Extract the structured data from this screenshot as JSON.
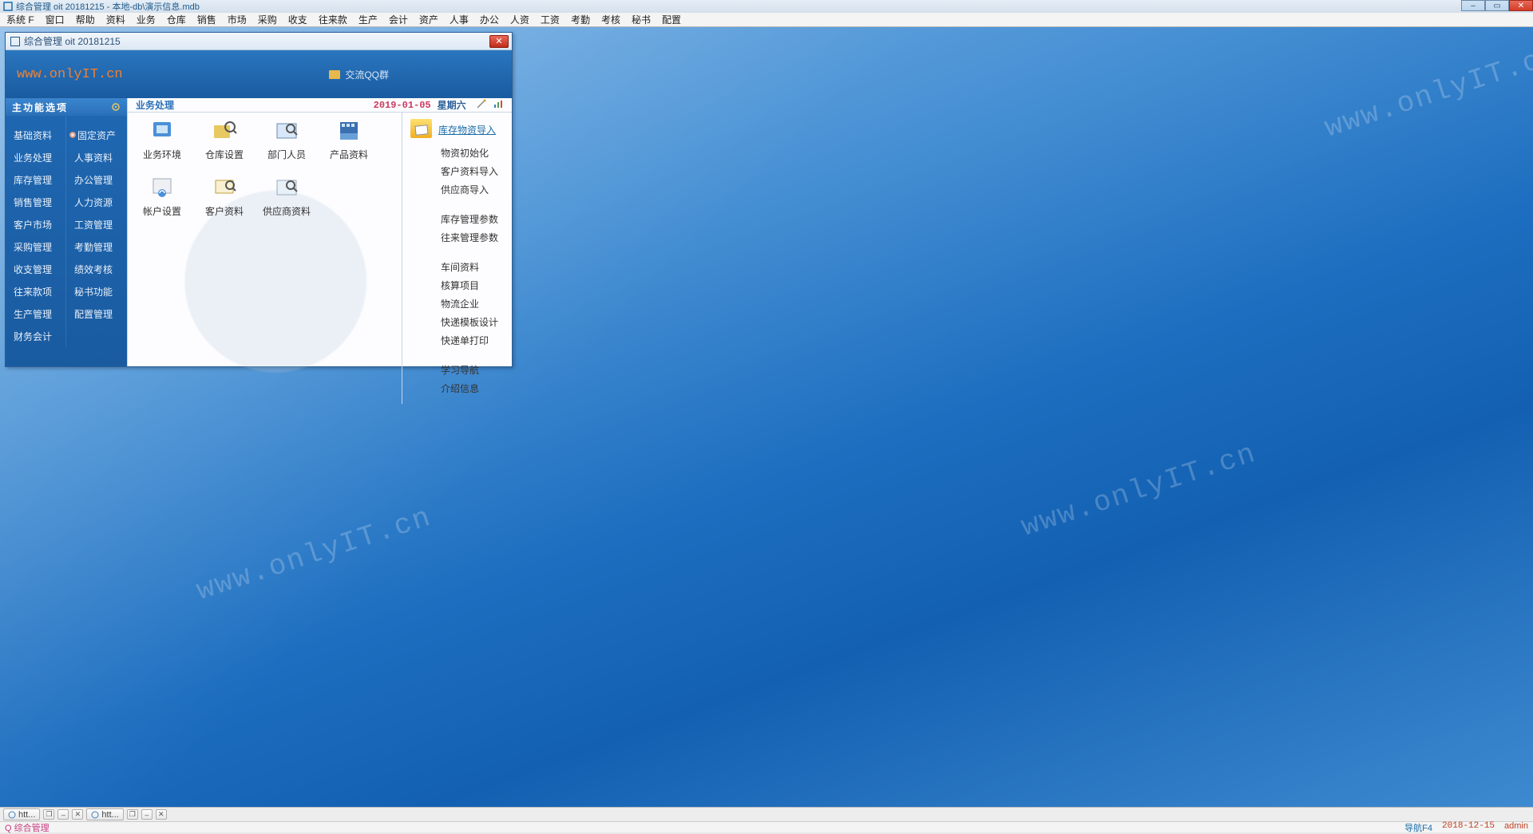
{
  "app": {
    "title": "综合管理 oit 20181215 - 本地-db\\演示信息.mdb",
    "window_buttons": {
      "min": "–",
      "max": "▭",
      "close": "✕"
    }
  },
  "menubar": [
    "系统 F",
    "窗口",
    "帮助",
    "资料",
    "业务",
    "仓库",
    "销售",
    "市场",
    "采购",
    "收支",
    "往来款",
    "生产",
    "会计",
    "资产",
    "人事",
    "办公",
    "人资",
    "工资",
    "考勤",
    "考核",
    "秘书",
    "配置"
  ],
  "child": {
    "title": "综合管理 oit 20181215",
    "url": "www.onlyIT.cn",
    "qq_label": "交流QQ群",
    "sidebar": {
      "header": "主功能选项",
      "col1": [
        "基础资料",
        "业务处理",
        "库存管理",
        "销售管理",
        "客户市场",
        "采购管理",
        "收支管理",
        "往来款项",
        "生产管理",
        "财务会计"
      ],
      "col2": [
        "固定资产",
        "人事资料",
        "办公管理",
        "人力资源",
        "工资管理",
        "考勤管理",
        "绩效考核",
        "秘书功能",
        "配置管理"
      ]
    },
    "main": {
      "header_label": "业务处理",
      "date": "2019-01-05",
      "day": "星期六",
      "icons_row1": [
        "业务环境",
        "仓库设置",
        "部门人员",
        "产品资料"
      ],
      "icons_row2": [
        "帐户设置",
        "客户资料",
        "供应商资料"
      ],
      "links": {
        "top": "库存物资导入",
        "group1": [
          "物资初始化",
          "客户资料导入",
          "供应商导入"
        ],
        "group2": [
          "库存管理参数",
          "往来管理参数"
        ],
        "group3": [
          "车间资料",
          "核算项目",
          "物流企业",
          "快递模板设计",
          "快递单打印"
        ],
        "group4": [
          "学习导航",
          "介绍信息"
        ]
      }
    }
  },
  "taskbar": {
    "item": "htt..."
  },
  "statusbar": {
    "left": "Q 综合管理",
    "nav": "导航F4",
    "date": "2018-12-15",
    "user": "admin"
  },
  "watermark": "www.onlyIT.cn"
}
